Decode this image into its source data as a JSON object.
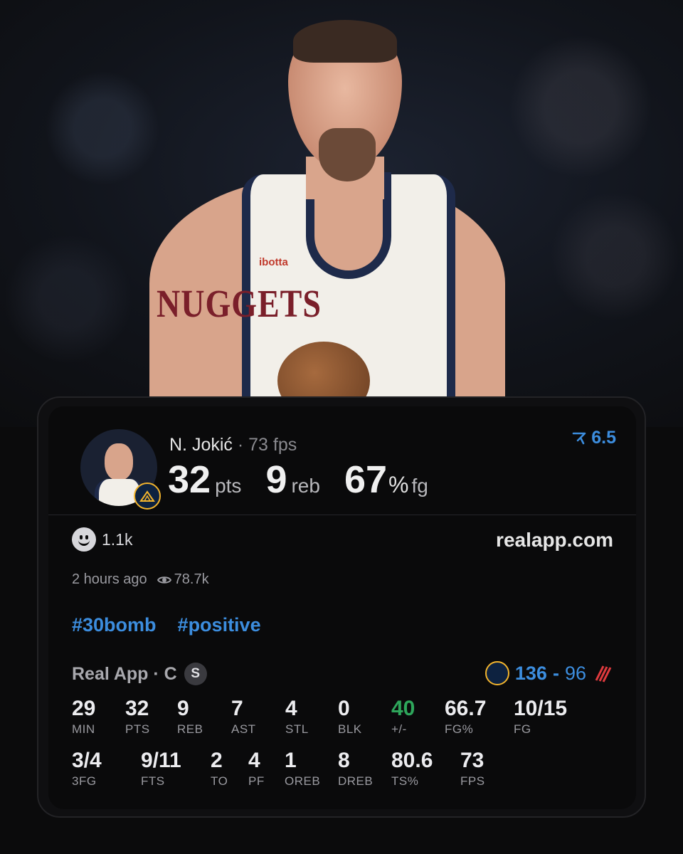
{
  "hero": {
    "jersey_text": "NUGGETS",
    "sponsor": "ibotta"
  },
  "card": {
    "player": {
      "name": "N. Jokić",
      "separator": "·",
      "fps_label": "73 fps",
      "pts_value": "32",
      "pts_unit": "pts",
      "reb_value": "9",
      "reb_unit": "reb",
      "fg_value": "67",
      "fg_pct": "%",
      "fg_unit": "fg"
    },
    "rating": "6.5",
    "reactions": "1.1k",
    "site": "realapp.com",
    "time_ago": "2 hours ago",
    "views": "78.7k",
    "tags": [
      "#30bomb",
      "#positive"
    ],
    "league": {
      "label": "Real App · C",
      "badge": "S"
    },
    "score": {
      "home": "136",
      "dash": "-",
      "away": "96"
    },
    "box_score": {
      "row1": [
        {
          "value": "29",
          "label": "MIN"
        },
        {
          "value": "32",
          "label": "PTS"
        },
        {
          "value": "9",
          "label": "REB"
        },
        {
          "value": "7",
          "label": "AST"
        },
        {
          "value": "4",
          "label": "STL"
        },
        {
          "value": "0",
          "label": "BLK"
        },
        {
          "value": "40",
          "label": "+/-"
        },
        {
          "value": "66.7",
          "label": "FG%"
        },
        {
          "value": "10/15",
          "label": "FG"
        }
      ],
      "row2": [
        {
          "value": "3/4",
          "label": "3FG"
        },
        {
          "value": "9/11",
          "label": "FTS"
        },
        {
          "value": "2",
          "label": "TO"
        },
        {
          "value": "4",
          "label": "PF"
        },
        {
          "value": "1",
          "label": "OREB"
        },
        {
          "value": "8",
          "label": "DREB"
        },
        {
          "value": "80.6",
          "label": "TS%"
        },
        {
          "value": "73",
          "label": "FPS"
        }
      ]
    }
  },
  "colors": {
    "accent": "#3c8dde",
    "positive": "#2ea65b",
    "background": "#0b0b0c"
  }
}
